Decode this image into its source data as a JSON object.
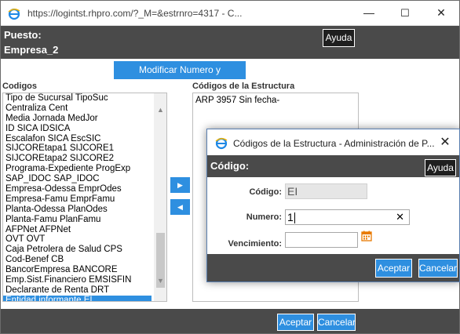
{
  "window": {
    "title": "https://logintst.rhpro.com/?_M=&estrnro=4317 - C...",
    "minimize": "—",
    "maximize": "☐",
    "close": "✕"
  },
  "header": {
    "puesto": "Puesto:",
    "empresa": "Empresa_2",
    "help_label": "Ayuda"
  },
  "modify_button": "Modificar Numero y Vencimiento",
  "left_panel": {
    "label": "Codigos",
    "items": [
      "Tipo de Sucursal   TipoSuc",
      "Centraliza   Cent",
      "Media Jornada   MedJor",
      "ID SICA   IDSICA",
      "Escalafon SICA   EscSIC",
      "SIJCOREtapa1   SIJCORE1",
      "SIJCOREtapa2   SIJCORE2",
      "Programa-Expediente   ProgExp",
      "SAP_IDOC   SAP_IDOC",
      "Empresa-Odessa   EmprOdes",
      "Empresa-Famu   EmprFamu",
      "Planta-Odessa   PlanOdes",
      "Planta-Famu   PlanFamu",
      "AFPNet   AFPNet",
      "OVT   OVT",
      "Caja Petrolera de Salud   CPS",
      "Cod-Benef   CB",
      "BancorEmpresa   BANCORE",
      "Emp.Sist.Financiero   EMSISFIN",
      "Declarante de Renta   DRT",
      "Entidad informante   EI"
    ],
    "selected_index": 20
  },
  "move_right_label": "▶",
  "move_left_label": "◀",
  "right_panel": {
    "label": "Códigos de la Estructura",
    "items": [
      "ARP 3957 Sin fecha-"
    ]
  },
  "footer": {
    "accept_label": "Aceptar",
    "cancel_label": "Cancelar"
  },
  "dialog": {
    "title": "Códigos de la Estructura - Administración de P...",
    "close": "✕",
    "header_title": "Código:",
    "help_label": "Ayuda",
    "codigo_label": "Código:",
    "codigo_value": "EI",
    "numero_label": "Numero:",
    "numero_value": "1",
    "vencimiento_label": "Vencimiento:",
    "vencimiento_value": "",
    "accept_label": "Aceptar",
    "cancel_label": "Cancelar"
  },
  "colors": {
    "accent": "#2e8fe0",
    "bar": "#4a4a4a",
    "calendar": "#e87a00"
  }
}
